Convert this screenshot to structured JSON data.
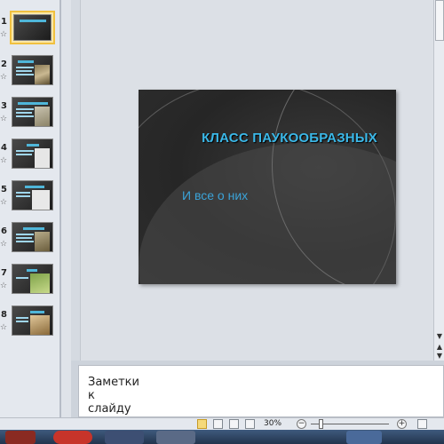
{
  "slides": [
    {
      "number": "1",
      "star": "☆",
      "selected": true
    },
    {
      "number": "2",
      "star": "☆",
      "selected": false
    },
    {
      "number": "3",
      "star": "☆",
      "selected": false
    },
    {
      "number": "4",
      "star": "☆",
      "selected": false
    },
    {
      "number": "5",
      "star": "☆",
      "selected": false
    },
    {
      "number": "6",
      "star": "☆",
      "selected": false
    },
    {
      "number": "7",
      "star": "☆",
      "selected": false
    },
    {
      "number": "8",
      "star": "☆",
      "selected": false
    }
  ],
  "current_slide": {
    "title": "КЛАСС ПАУКООБРАЗНЫХ",
    "subtitle": "И все о них"
  },
  "notes": {
    "placeholder": "Заметки к слайду"
  },
  "statusbar": {
    "zoom": "30%",
    "zoom_minus": "−",
    "zoom_plus": "+"
  },
  "colors": {
    "title": "#3bb8e8",
    "subtitle": "#3ba3d8",
    "selected_thumb": "#f0c040"
  }
}
